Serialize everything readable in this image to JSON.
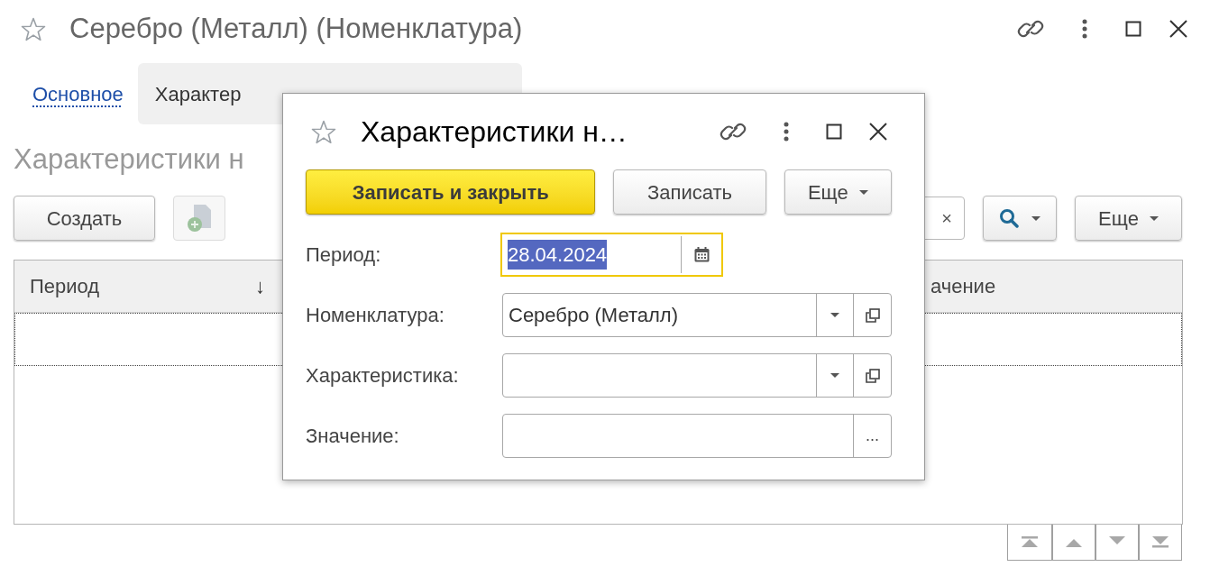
{
  "window": {
    "title": "Серебро (Металл) (Номенклатура)"
  },
  "tabs": [
    {
      "label": "Основное",
      "selected": false
    },
    {
      "label": "Характер",
      "selected": true
    }
  ],
  "section_title": "Характеристики н",
  "toolbar": {
    "create": "Создать",
    "search_clear": "×",
    "more": "Еще"
  },
  "table": {
    "columns": [
      {
        "label": "Период",
        "sort": "↓"
      },
      {
        "label": "ачение"
      }
    ],
    "rows": [
      {
        "selected": true
      }
    ]
  },
  "dialog": {
    "title": "Характеристики н…",
    "buttons": [
      {
        "label": "Записать и закрыть",
        "kind": "primary"
      },
      {
        "label": "Записать",
        "kind": "plain"
      },
      {
        "label": "Еще",
        "kind": "menu"
      }
    ],
    "fields": [
      {
        "label": "Период:",
        "value": "28.04.2024",
        "kind": "date",
        "focused": true
      },
      {
        "label": "Номенклатура:",
        "value": "Серебро (Металл)",
        "kind": "select",
        "focused": false
      },
      {
        "label": "Характеристика:",
        "kind": "select",
        "focused": false
      },
      {
        "label": "Значение:",
        "kind": "choice",
        "button": "...",
        "focused": false
      }
    ]
  }
}
